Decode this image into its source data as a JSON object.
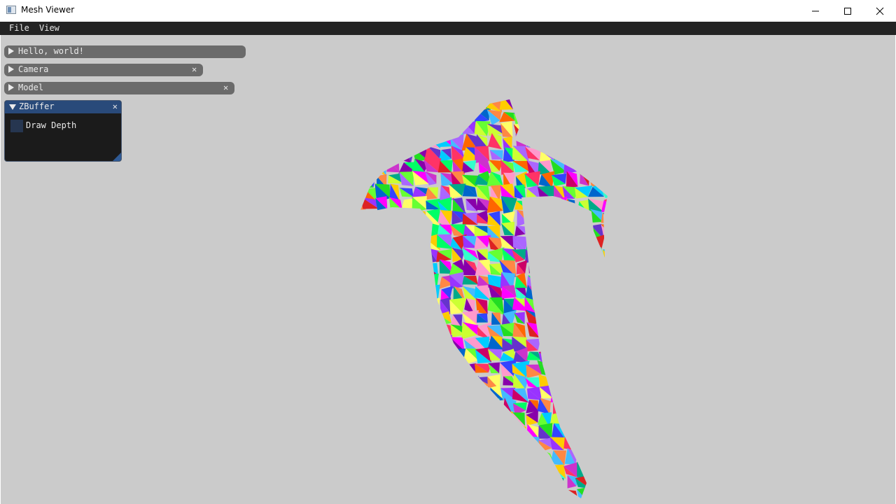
{
  "window": {
    "title": "Mesh Viewer",
    "controls": {
      "minimize_icon": "minimize-icon",
      "maximize_icon": "maximize-icon",
      "close_icon": "close-icon"
    }
  },
  "menubar": {
    "items": [
      "File",
      "View"
    ]
  },
  "panels": [
    {
      "title": "Hello, world!",
      "collapsed": true,
      "has_close": false
    },
    {
      "title": "Camera",
      "collapsed": true,
      "has_close": true
    },
    {
      "title": "Model",
      "collapsed": true,
      "has_close": true
    }
  ],
  "zbuffer": {
    "title": "ZBuffer",
    "collapsed": false,
    "checkbox": {
      "label": "Draw Depth",
      "checked": false
    }
  },
  "close_glyph": "✕",
  "viewport": {
    "background": "#cbcbcb",
    "content": "dolphin mesh with randomly colored triangles"
  },
  "colors": {
    "menubar": "#232323",
    "collapsed_header": "#6b6b6b",
    "active_header": "#294a7a",
    "window_bg": "#1b1b1b"
  }
}
